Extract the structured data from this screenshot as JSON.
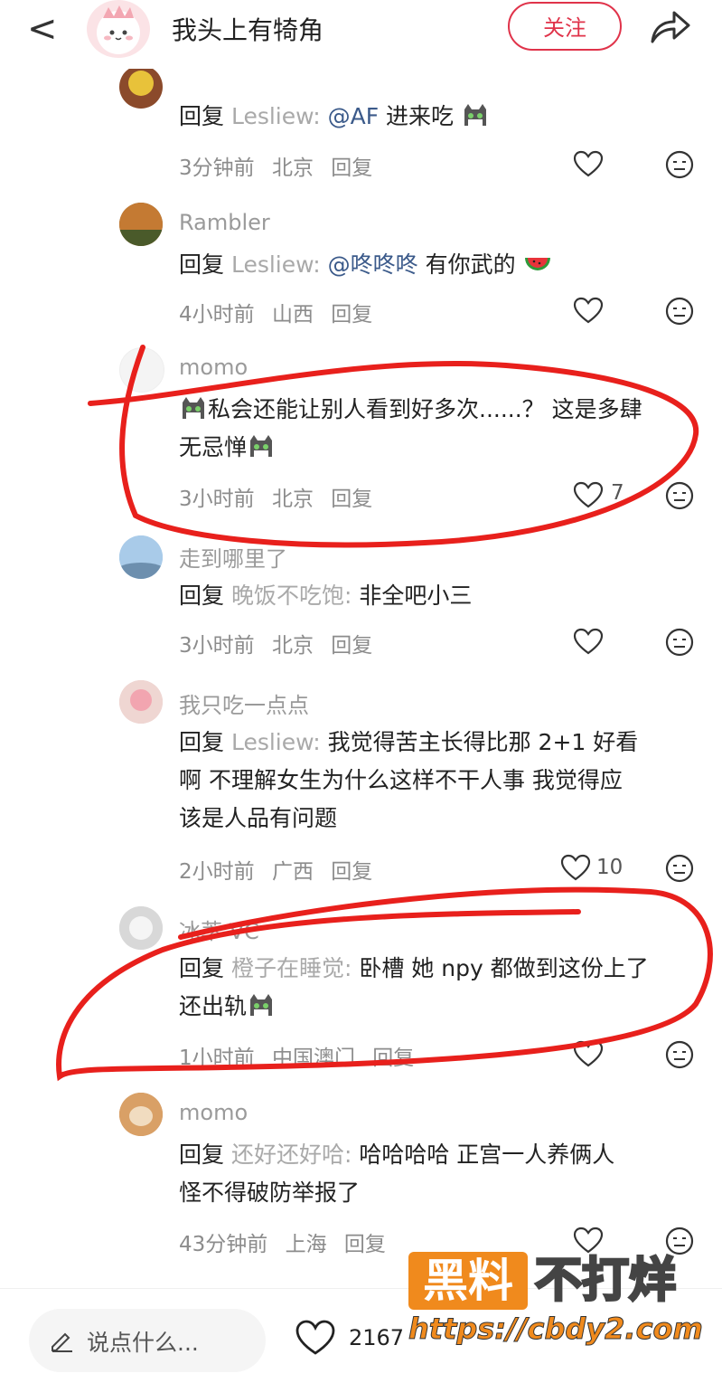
{
  "header": {
    "back_glyph": "<",
    "author_name": "我头上有犄角",
    "follow_label": "关注"
  },
  "comments": [
    {
      "username": "",
      "prefix": "回复",
      "target": "Lesliew:",
      "mention": "@AF",
      "text": "进来吃",
      "time": "3分钟前",
      "location": "北京",
      "reply_label": "回复",
      "likes": ""
    },
    {
      "username": "Rambler",
      "prefix": "回复",
      "target": "Lesliew:",
      "mention": "@咚咚咚",
      "text": "有你武的",
      "time": "4小时前",
      "location": "山西",
      "reply_label": "回复",
      "likes": ""
    },
    {
      "username": "momo",
      "text_line1": "私会还能让别人看到好多次......？ 这是多肆",
      "text_line2": "无忌惮",
      "time": "3小时前",
      "location": "北京",
      "reply_label": "回复",
      "likes": "7"
    },
    {
      "username": "走到哪里了",
      "prefix": "回复",
      "target": "晚饭不吃饱:",
      "text": "非全吧小三",
      "time": "3小时前",
      "location": "北京",
      "reply_label": "回复",
      "likes": ""
    },
    {
      "username": "我只吃一点点",
      "prefix": "回复",
      "target": "Lesliew:",
      "text_line1": "我觉得苦主长得比那 2+1 好看",
      "text_line2": "啊 不理解女生为什么这样不干人事 我觉得应",
      "text_line3": "该是人品有问题",
      "time": "2小时前",
      "location": "广西",
      "reply_label": "回复",
      "likes": "10"
    },
    {
      "username": "冰萃 VC",
      "prefix": "回复",
      "target": "橙子在睡觉:",
      "text_line1": "卧槽 她 npy 都做到这份上了",
      "text_line2": "还出轨",
      "time": "1小时前",
      "location": "中国澳门",
      "reply_label": "回复",
      "likes": ""
    },
    {
      "username": "momo",
      "prefix": "回复",
      "target": "还好还好哈:",
      "text_line1": "哈哈哈哈 正宫一人养俩人",
      "text_line2": "怪不得破防举报了",
      "time": "43分钟前",
      "location": "上海",
      "reply_label": "回复",
      "likes": ""
    }
  ],
  "bottom_bar": {
    "input_placeholder": "说点什么...",
    "like_count": "2167"
  },
  "watermark": {
    "box_text": "黑料",
    "right_text": "不打烊",
    "url": "https://cbdy2.com"
  },
  "colors": {
    "accent": "#e0334a",
    "annotation_red": "#e8201c",
    "watermark_orange": "#f08a1d"
  }
}
